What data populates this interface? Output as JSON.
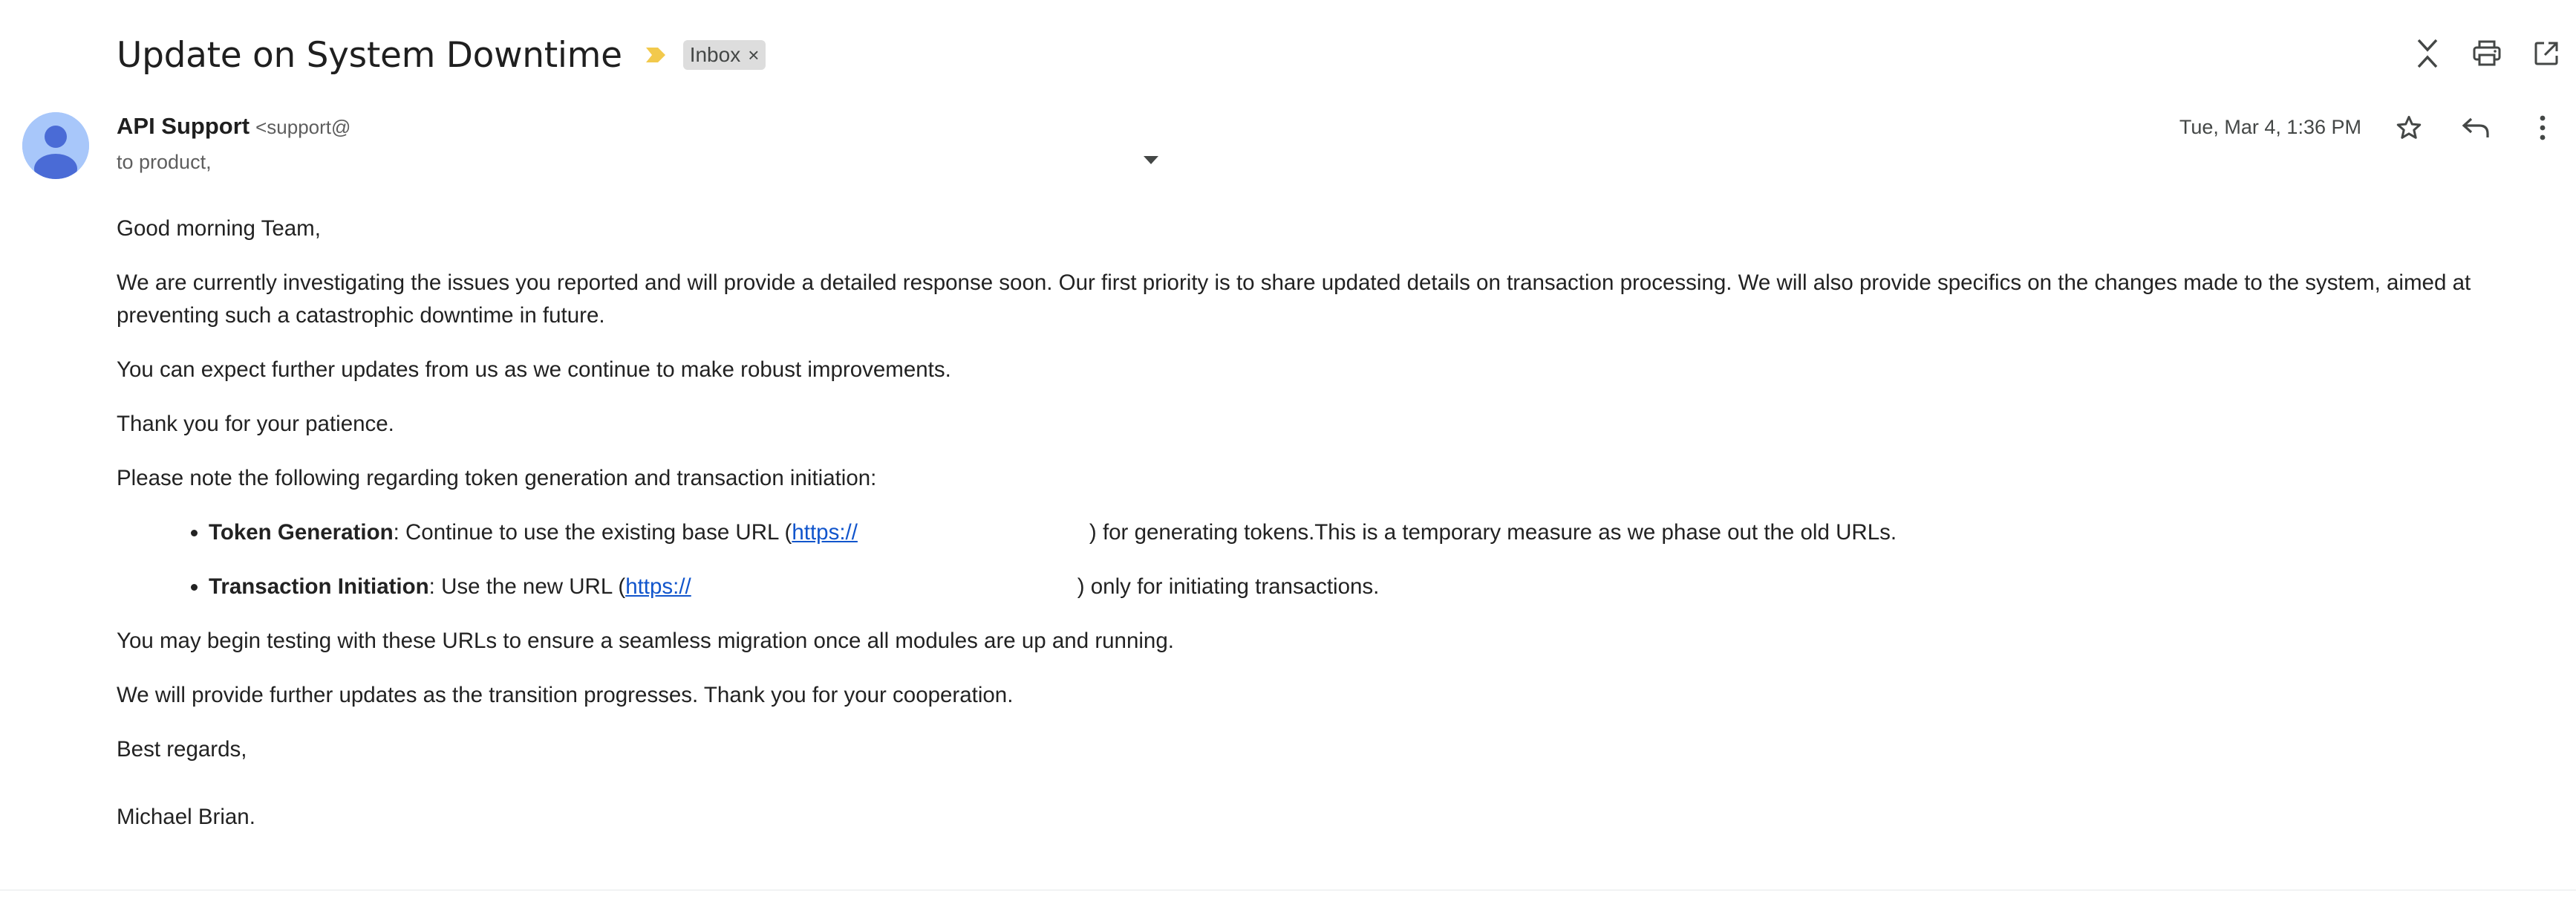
{
  "email": {
    "subject": "Update on System Downtime",
    "label": "Inbox",
    "label_remove": "×",
    "sender_name": "API Support",
    "sender_email": "<support@",
    "to_text": "to product,",
    "date": "Tue, Mar 4, 1:36 PM"
  },
  "icons": {
    "importance": "importance-marker-icon",
    "collapse": "collapse-all-icon",
    "print": "print-icon",
    "open_new_window": "open-in-new-window-icon",
    "star": "star-icon",
    "reply": "reply-icon",
    "more": "more-vertical-icon",
    "dropdown": "caret-down-icon",
    "avatar": "default-avatar-icon"
  },
  "colors": {
    "importance": "#f2c94c",
    "avatar_bg": "#a8c7fa",
    "avatar_fg": "#4a6bd6",
    "link": "#1155cc",
    "chip_bg": "#dddddd"
  },
  "body": {
    "greeting": "Good morning Team,",
    "p1": "We are currently investigating the issues you reported and will provide a detailed response soon. Our first priority is to share updated details on transaction processing. We will also provide specifics on the changes made to the system, aimed at preventing such a catastrophic downtime in future.",
    "p2": "You can expect further updates from us as we continue to make robust improvements.",
    "p3": "Thank you for your patience.",
    "p4": "Please note the following regarding token generation and transaction initiation:",
    "bullets": [
      {
        "term": "Token Generation",
        "pre": ": Continue to use the existing base URL (",
        "link": "https://",
        "post": ") for generating tokens.This is a temporary measure as we phase out the old URLs."
      },
      {
        "term": "Transaction Initiation",
        "pre": ": Use the new URL (",
        "link": "https://",
        "post": ") only for initiating transactions."
      }
    ],
    "p5": "You may begin testing with these URLs to ensure a seamless migration once all modules are up and running.",
    "p6": "We will provide further updates as the transition progresses. Thank you for your cooperation.",
    "signoff": "Best regards,",
    "signature": "Michael Brian."
  }
}
